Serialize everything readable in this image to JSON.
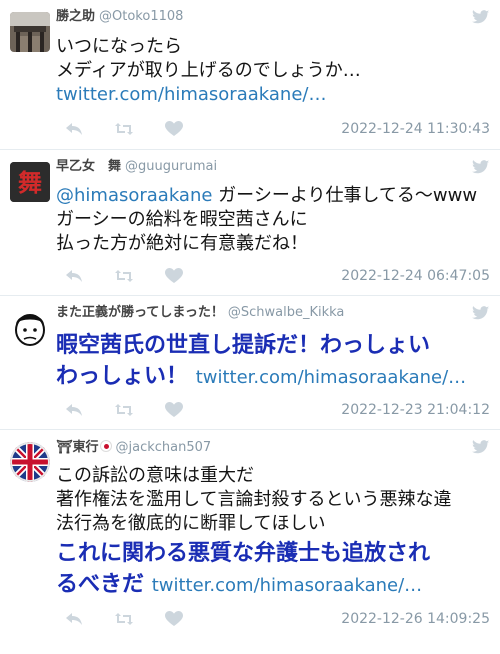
{
  "tweets": [
    {
      "name": "勝之助",
      "handle": "@Otoko1108",
      "lines": [
        "いつになったら",
        "メディアが取り上げるのでしょうか…"
      ],
      "link": "twitter.com/himasoraakane/…",
      "timestamp": "2022-12-24 11:30:43"
    },
    {
      "name": "早乙女　舞",
      "handle": "@guugurumai",
      "mention": "@himasoraakane",
      "first_line_rest": " ガーシーより仕事してる〜www",
      "lines": [
        "ガーシーの給料を暇空茜さんに",
        "払った方が絶対に有意義だね！"
      ],
      "timestamp": "2022-12-24 06:47:05"
    },
    {
      "name": "また正義が勝ってしまった！",
      "handle": "@Schwalbe_Kikka",
      "big_lines": [
        "暇空茜氏の世直し提訴だ！わっしょい",
        "わっしょい！"
      ],
      "link": "twitter.com/himasoraakane/…",
      "timestamp": "2022-12-23 21:04:12"
    },
    {
      "name_prefix": "⛩東行",
      "handle": "@jackchan507",
      "lines": [
        "この訴訟の意味は重大だ",
        "著作権法を濫用して言論封殺するという悪辣な違",
        "法行為を徹底的に断罪してほしい"
      ],
      "big_lines": [
        "これに関わる悪質な弁護士も追放され",
        "るべきだ"
      ],
      "link": "twitter.com/himasoraakane/…",
      "timestamp": "2022-12-26 14:09:25"
    }
  ],
  "colors": {
    "link": "#2b7bb9",
    "bold_blue": "#1a2db4",
    "meta": "#8899a6",
    "divider": "#e6ecf0"
  },
  "icons": [
    "twitter-bird-icon",
    "reply-icon",
    "retweet-icon",
    "like-icon"
  ]
}
